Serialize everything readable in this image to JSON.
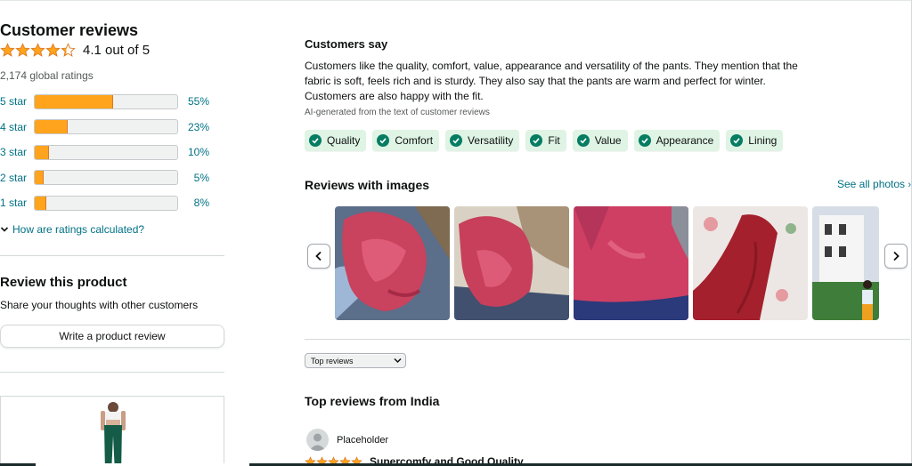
{
  "summary": {
    "title": "Customer reviews",
    "rating_value": 4.1,
    "rating_text": "4.1 out of 5",
    "global_ratings": "2,174 global ratings",
    "star_color": "#ffa41c"
  },
  "histogram": [
    {
      "label": "5 star",
      "percent_text": "55%",
      "fraction": 0.55
    },
    {
      "label": "4 star",
      "percent_text": "23%",
      "fraction": 0.23
    },
    {
      "label": "3 star",
      "percent_text": "10%",
      "fraction": 0.1
    },
    {
      "label": "2 star",
      "percent_text": "5%",
      "fraction": 0.05
    },
    {
      "label": "1 star",
      "percent_text": "8%",
      "fraction": 0.08
    }
  ],
  "how_calculated": "How are ratings calculated?",
  "review_product": {
    "title": "Review this product",
    "subtitle": "Share your thoughts with other customers",
    "button_label": "Write a product review"
  },
  "customers_say": {
    "title": "Customers say",
    "text": "Customers like the quality, comfort, value, appearance and versatility of the pants. They mention that the fabric is soft, feels rich and is sturdy. They also say that the pants are warm and perfect for winter. Customers are also happy with the fit.",
    "ai_note": "AI-generated from the text of customer reviews",
    "aspects": [
      "Quality",
      "Comfort",
      "Versatility",
      "Fit",
      "Value",
      "Appearance",
      "Lining"
    ]
  },
  "reviews_with_images": {
    "title": "Reviews with images",
    "see_all": "See all photos",
    "prev_icon": "chevron-left-icon",
    "next_icon": "chevron-right-icon"
  },
  "sort": {
    "selected": "Top reviews"
  },
  "top_reviews": {
    "title": "Top reviews from India",
    "first_review": {
      "reviewer": "Placeholder",
      "stars": 5,
      "title": "Supercomfy and Good Quality"
    }
  },
  "colors": {
    "link": "#007185",
    "accent": "#ffa41c",
    "chip_bg": "#dff4e4",
    "check": "#067d62"
  }
}
